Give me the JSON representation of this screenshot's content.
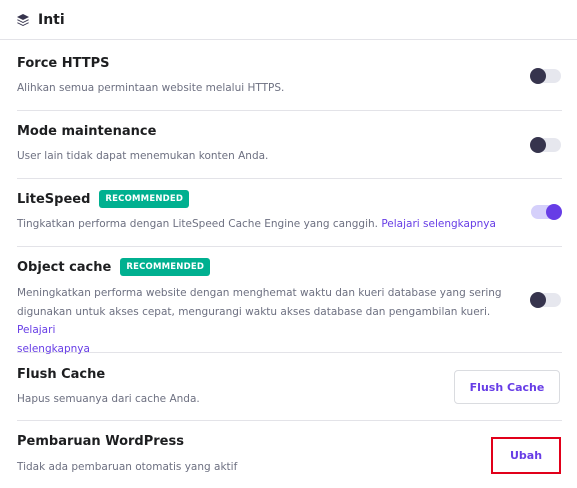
{
  "header": {
    "title": "Inti",
    "icon": "layers-icon"
  },
  "rows": [
    {
      "label": "Force HTTPS",
      "desc": "Alihkan semua permintaan website melalui HTTPS.",
      "toggle": "off"
    },
    {
      "label": "Mode maintenance",
      "desc": "User lain tidak dapat menemukan konten Anda.",
      "toggle": "off"
    },
    {
      "label": "LiteSpeed",
      "badge": "RECOMMENDED",
      "desc": "Tingkatkan performa dengan LiteSpeed Cache Engine yang canggih.",
      "link": "Pelajari selengkapnya",
      "toggle": "on"
    },
    {
      "label": "Object cache",
      "badge": "RECOMMENDED",
      "desc_line1": "Meningkatkan performa website dengan menghemat waktu dan kueri database yang sering",
      "desc_line2": "digunakan untuk akses cepat, mengurangi waktu akses database dan pengambilan kueri.",
      "link_part1": "Pelajari",
      "link_part2": "selengkapnya",
      "toggle": "off"
    },
    {
      "label": "Flush Cache",
      "desc": "Hapus semuanya dari cache Anda.",
      "button": "Flush Cache"
    },
    {
      "label": "Pembaruan WordPress",
      "desc": "Tidak ada pembaruan otomatis yang aktif",
      "button": "Ubah"
    }
  ],
  "colors": {
    "accent": "#673de6",
    "badge": "#00b090",
    "highlight": "#e1001a"
  }
}
